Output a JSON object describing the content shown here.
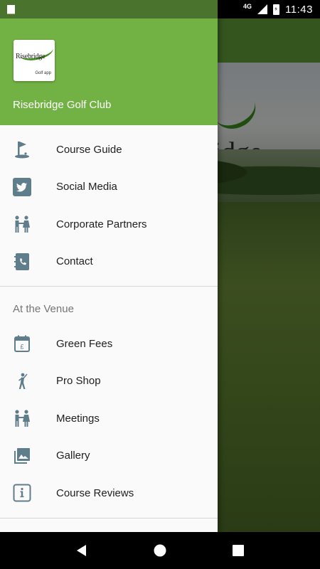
{
  "status_bar": {
    "network": "4G",
    "time": "11:43"
  },
  "drawer": {
    "header": {
      "logo_text": "Risebridge",
      "logo_subtext": "Golf app",
      "club_name": "Risebridge Golf Club"
    },
    "primary_items": [
      {
        "label": "Course Guide",
        "icon": "golf-flag-icon"
      },
      {
        "label": "Social Media",
        "icon": "twitter-icon"
      },
      {
        "label": "Corporate Partners",
        "icon": "handshake-icon"
      },
      {
        "label": "Contact",
        "icon": "phone-book-icon"
      }
    ],
    "section_title": "At the Venue",
    "venue_items": [
      {
        "label": "Green Fees",
        "icon": "calendar-pound-icon"
      },
      {
        "label": "Pro Shop",
        "icon": "golfer-icon"
      },
      {
        "label": "Meetings",
        "icon": "handshake-icon"
      },
      {
        "label": "Gallery",
        "icon": "gallery-icon"
      },
      {
        "label": "Course Reviews",
        "icon": "info-icon"
      }
    ]
  },
  "background": {
    "logo_fragment": "idge"
  },
  "colors": {
    "header_green": "#72b245",
    "icon_grey": "#607d8b"
  }
}
